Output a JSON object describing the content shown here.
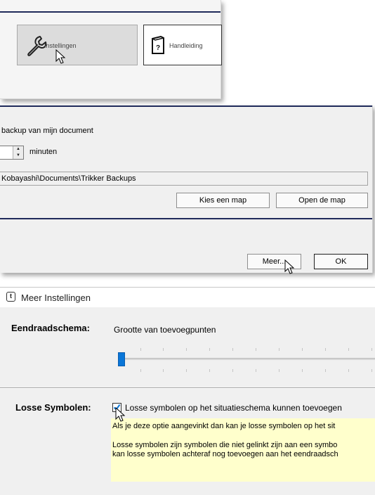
{
  "toolbar": {
    "instellingen_label": "Instellingen",
    "handleiding_label": "Handleiding",
    "accent_color": "#1f2a5a"
  },
  "backup": {
    "heading": "backup van mijn document",
    "interval_unit": "minuten",
    "folder_path": "Kobayashi\\Documents\\Trikker Backups",
    "choose_folder_label": "Kies een map",
    "open_folder_label": "Open de map",
    "more_label": "Meer...",
    "ok_label": "OK"
  },
  "meer_instellingen": {
    "window_title": "Meer Instellingen",
    "app_icon_glyph": "t",
    "eendraadschema_title": "Eendraadschema:",
    "point_size_label": "Grootte van toevoegpunten",
    "point_size_level": 0,
    "losse_title": "Losse Symbolen:",
    "losse_checkbox_label": "Losse symbolen op het situatieschema kunnen toevoegen",
    "losse_checked": true,
    "note_line1": "Als je deze optie aangevinkt dan kan je losse symbolen op het sit",
    "note_line2": "Losse symbolen zijn symbolen die niet gelinkt zijn aan een symbo",
    "note_line3": "kan losse symbolen achteraf nog toevoegen aan het eendraadsch",
    "note_color": "#ffffcc",
    "slider_color": "#0a76d8"
  }
}
